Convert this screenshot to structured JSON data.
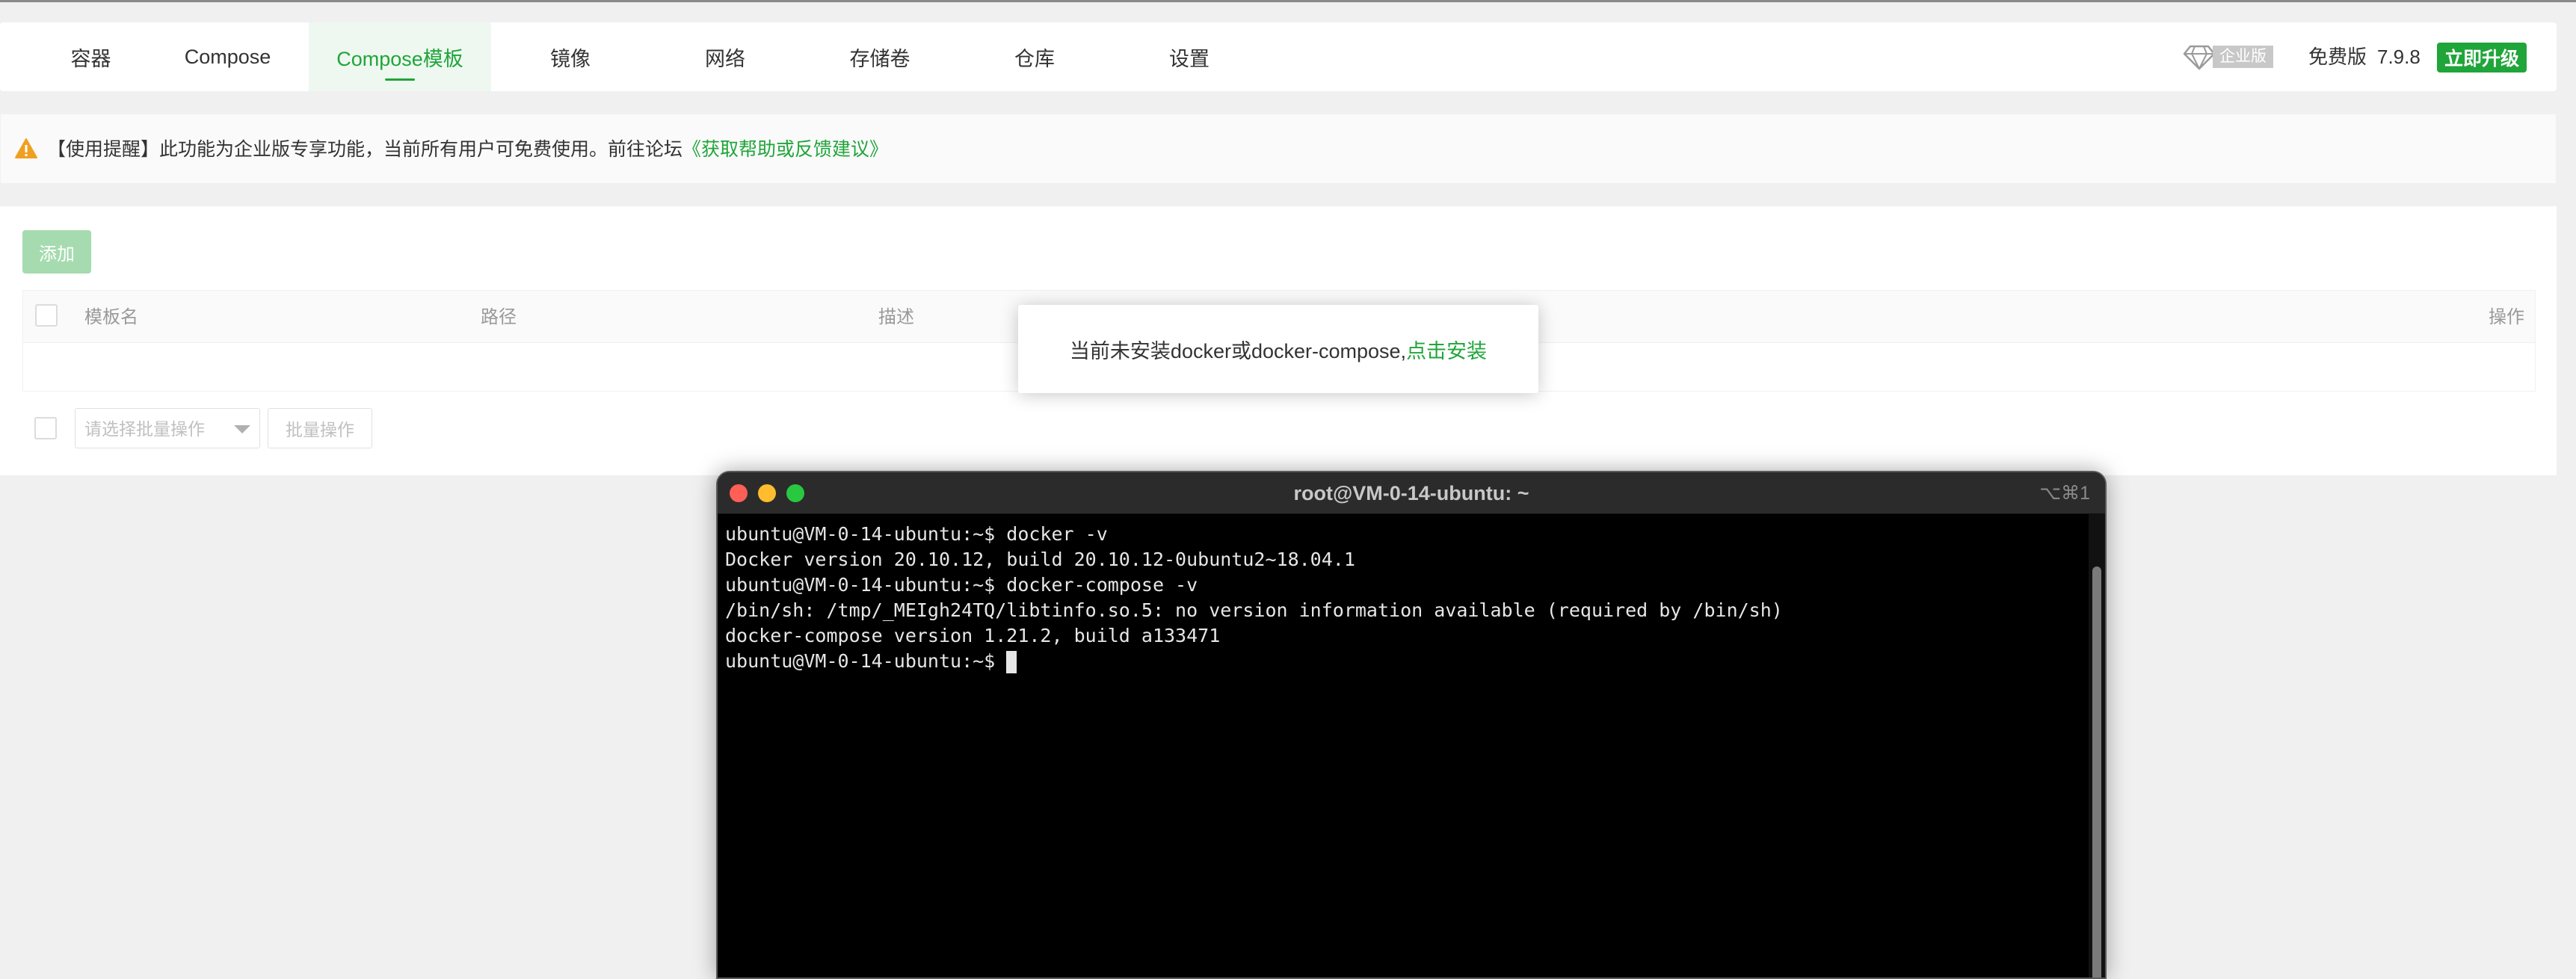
{
  "tabs": [
    {
      "label": "容器",
      "active": false
    },
    {
      "label": "Compose",
      "active": false
    },
    {
      "label": "Compose模板",
      "active": true
    },
    {
      "label": "镜像",
      "active": false
    },
    {
      "label": "网络",
      "active": false
    },
    {
      "label": "存储卷",
      "active": false
    },
    {
      "label": "仓库",
      "active": false
    },
    {
      "label": "设置",
      "active": false
    }
  ],
  "header_right": {
    "enterprise_badge": "企业版",
    "free_label": "免费版",
    "version": "7.9.8",
    "upgrade_button": "立即升级"
  },
  "notice": {
    "icon": "warning-icon",
    "text": "【使用提醒】此功能为企业版专享功能，当前所有用户可免费使用。前往论坛",
    "link": "《获取帮助或反馈建议》"
  },
  "toolbar": {
    "add_button": "添加"
  },
  "table": {
    "columns": [
      "模板名",
      "路径",
      "描述",
      "操作"
    ]
  },
  "batch": {
    "select_placeholder": "请选择批量操作",
    "button": "批量操作"
  },
  "popup": {
    "text": "当前未安装docker或docker-compose,",
    "link": "点击安装"
  },
  "terminal": {
    "title": "root@VM-0-14-ubuntu: ~",
    "shortcut": "⌥⌘1",
    "lines": [
      "ubuntu@VM-0-14-ubuntu:~$ docker -v",
      "Docker version 20.10.12, build 20.10.12-0ubuntu2~18.04.1",
      "ubuntu@VM-0-14-ubuntu:~$ docker-compose -v",
      "/bin/sh: /tmp/_MEIgh24TQ/libtinfo.so.5: no version information available (required by /bin/sh)",
      "docker-compose version 1.21.2, build a133471",
      "ubuntu@VM-0-14-ubuntu:~$ "
    ]
  },
  "colors": {
    "accent": "#20a53a",
    "warning": "#f0a020",
    "terminal_bg": "#000000"
  }
}
